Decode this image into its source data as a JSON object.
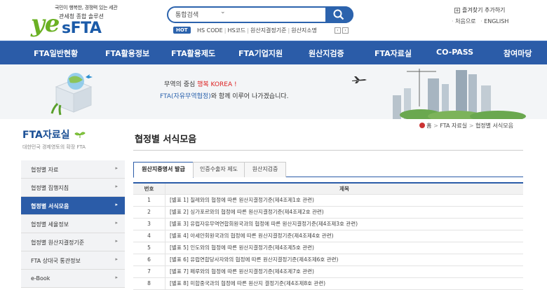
{
  "header": {
    "logo_tagline_1": "국민이 행복한, 경쟁력 있는 세관",
    "logo_tagline_2": "관세청 종합 솔루션",
    "logo_ye": "ye",
    "logo_sfta": "sFTA",
    "search_select": "통합검색",
    "hot_label": "HOT",
    "hot_links": [
      "HS CODE",
      "HS코드",
      "원산지결정기준",
      "원산지소명"
    ],
    "favorites": "즐겨찾기 추가하기",
    "home_link": "처음으로",
    "english_link": "ENGLISH"
  },
  "gnb": [
    "FTA일반현황",
    "FTA활용정보",
    "FTA활용제도",
    "FTA기업지원",
    "원산지검증",
    "FTA자료실",
    "CO-PASS",
    "참여마당"
  ],
  "banner": {
    "line1_pre": "무역의 중심 ",
    "line1_em": "행복 KOREA !",
    "line2_em": "FTA(자유무역협정)",
    "line2_post": "와 함께 이루어 나가겠습니다."
  },
  "sidebar": {
    "title": "FTA자료실",
    "subtitle": "대한민국 경제영토의 확장 FTA",
    "items": [
      {
        "label": "협정별 자료",
        "active": false
      },
      {
        "label": "협정별 집행지침",
        "active": false
      },
      {
        "label": "협정별 서식모음",
        "active": true
      },
      {
        "label": "협정별 세율정보",
        "active": false
      },
      {
        "label": "협정별 원산지결정기준",
        "active": false
      },
      {
        "label": "FTA 상대국 통관정보",
        "active": false
      },
      {
        "label": "e-Book",
        "active": false
      }
    ]
  },
  "main": {
    "title": "협정별 서식모음",
    "breadcrumb": [
      "홈",
      "FTA 자료실",
      "협정별 서식모음"
    ],
    "tabs": [
      "원산지증명서 발급",
      "인증수출자 제도",
      "원산지검증"
    ],
    "table": {
      "headers": [
        "번호",
        "제목"
      ],
      "rows": [
        {
          "no": "1",
          "title": "[별표 1] 칠레와의 협정에 따른 원산지결정기준(제4조제1호 관련)"
        },
        {
          "no": "2",
          "title": "[별표 2] 싱가포르와의 협정에 따른 원산지결정기준(제4조제2호 관련)"
        },
        {
          "no": "3",
          "title": "[별표 3] 유럽자유무역연합회원국과의 협정에 따른 원산지결정기준(제4조제3호 관련)"
        },
        {
          "no": "4",
          "title": "[별표 4] 아세안회원국과의 협정에 따른 원산지결정기준(제4조제4호 관련)"
        },
        {
          "no": "5",
          "title": "[별표 5] 인도와의 협정에 따른 원산지결정기준(제4조제5호 관련)"
        },
        {
          "no": "6",
          "title": "[별표 6] 유럽연합당사자와의 협정에 따른 원산지결정기준(제4조제6호 관련)"
        },
        {
          "no": "7",
          "title": "[별표 7] 페루와의 협정에 따른 원산지결정기준(제4조제7호 관련)"
        },
        {
          "no": "8",
          "title": "[별표 8] 미합중국과의 협정에 따른 원산지 결정기준(제4조제8호 관련)"
        }
      ]
    }
  },
  "colors": {
    "primary": "#2b5ca8",
    "accent_green": "#6ab023",
    "accent_red": "#dd2222"
  }
}
